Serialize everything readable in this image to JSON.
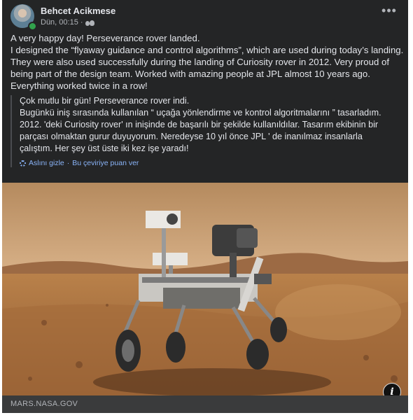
{
  "post": {
    "author": "Behcet Acikmese",
    "timestamp": "Dün, 00:15 ·",
    "audience_icon": "friends-icon",
    "more_icon": "more-options-icon",
    "text_lines": [
      "A very happy day! Perseverance rover landed.",
      "I designed the “flyaway guidance and control algorithms”, which are used during today’s landing.",
      "They were also used successfully during the landing of Curiosity rover in 2012. Very proud of",
      "being part of the design team. Worked with amazing people at JPL almost 10 years ago.",
      "Everything worked twice in a row!"
    ]
  },
  "translation": {
    "lines": [
      "Çok mutlu bir gün! Perseverance rover indi.",
      "Bugünkü iniş sırasında kullanılan “ uçağa yönlendirme ve kontrol algoritmalarını ” tasarladım.",
      "2012. 'deki Curiosity rover' ın inişinde de başarılı bir şekilde kullanıldılar. Tasarım ekibinin bir",
      "parçası olmaktan gurur duyuyorum. Neredeyse 10 yıl önce JPL ' de inanılmaz insanlarla",
      "çalıştım. Her şey üst üste iki kez işe yaradı!"
    ],
    "hide_original": "Aslını gizle",
    "separator": "·",
    "rate_translation": "Bu çeviriye puan ver"
  },
  "link": {
    "domain": "MARS.NASA.GOV",
    "info_icon_glyph": "i"
  },
  "colors": {
    "card_bg": "#242526",
    "text": "#e4e6eb",
    "secondary_text": "#b0b3b8",
    "link_blue": "#8ab4f8",
    "mars_sky": "#c9a476",
    "mars_ground": "#b07a45"
  }
}
